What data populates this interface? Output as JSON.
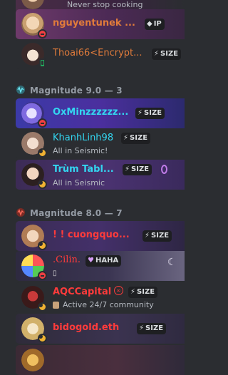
{
  "top_partial": {
    "activity": "Never stop cooking"
  },
  "members_top": [
    {
      "name": "nguyentunek ...",
      "tag": "IP",
      "tag_icon": "diamond-icon",
      "status": "dnd"
    },
    {
      "name": "Thoai66<Encrypt...",
      "tag": "SIZE",
      "tag_icon": "lightning-icon",
      "status": "mobile"
    }
  ],
  "section_9": {
    "title": "Magnitude 9.0 — 3"
  },
  "members_9": [
    {
      "name": "OxMinzzzzzz...",
      "tag": "SIZE",
      "tag_icon": "lightning-icon",
      "status": "dnd"
    },
    {
      "name": "KhanhLinh98",
      "tag": "SIZE",
      "tag_icon": "lightning-icon",
      "activity": "All in Seismic!",
      "status": "idle"
    },
    {
      "name": "Trùm Tabl...",
      "tag": "SIZE",
      "tag_icon": "lightning-icon",
      "activity": "All in Seismic",
      "status": "idle"
    }
  ],
  "section_8": {
    "title": "Magnitude 8.0 — 7"
  },
  "members_8": [
    {
      "name": "! ! cuongquo...",
      "tag": "SIZE",
      "tag_icon": "lightning-icon",
      "status": "idle"
    },
    {
      "name": ".Cilin.",
      "tag": "HAHA",
      "tag_icon": "heart-icon",
      "status": "dnd"
    },
    {
      "name": "AQCCapital",
      "tag": "SIZE",
      "tag_icon": "lightning-icon",
      "activity": "Active 24/7 community",
      "status": "idle"
    },
    {
      "name": "bidogold.eth",
      "tag": "SIZE",
      "tag_icon": "lightning-icon",
      "status": "idle"
    }
  ],
  "colors": {
    "background": "#2b2d31",
    "name_orange": "#e07b3b",
    "name_cyan": "#33d6f0",
    "name_red": "#ff3b3b",
    "name_gold": "#e6b84a"
  }
}
